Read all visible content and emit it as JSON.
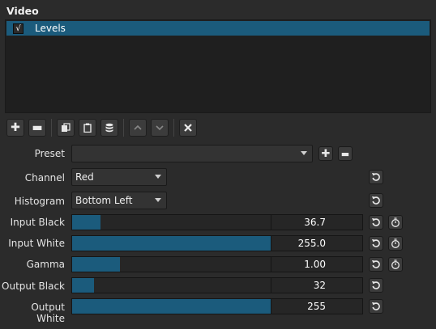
{
  "section_title": "Video",
  "filters": [
    {
      "label": "Levels",
      "checked": "√"
    }
  ],
  "toolbar": {
    "buttons": [
      "plus-icon",
      "minus-icon",
      "copy-icon",
      "paste-icon",
      "database-icon",
      "chevron-up-icon",
      "chevron-down-icon",
      "close-icon"
    ]
  },
  "form": {
    "preset": {
      "label": "Preset",
      "value": ""
    },
    "channel": {
      "label": "Channel",
      "value": "Red"
    },
    "histogram": {
      "label": "Histogram",
      "value": "Bottom Left"
    },
    "input_black": {
      "label": "Input Black",
      "value": "36.7",
      "level": 0.144
    },
    "input_white": {
      "label": "Input White",
      "value": "255.0",
      "level": 1.0
    },
    "gamma": {
      "label": "Gamma",
      "value": "1.00",
      "level": 0.24
    },
    "output_black": {
      "label": "Output Black",
      "value": "32",
      "level": 0.11
    },
    "output_white": {
      "label": "Output White",
      "value": "255",
      "level": 1.0
    }
  },
  "colors": {
    "accent": "#1b5b7c",
    "background": "#2b2b2b"
  }
}
